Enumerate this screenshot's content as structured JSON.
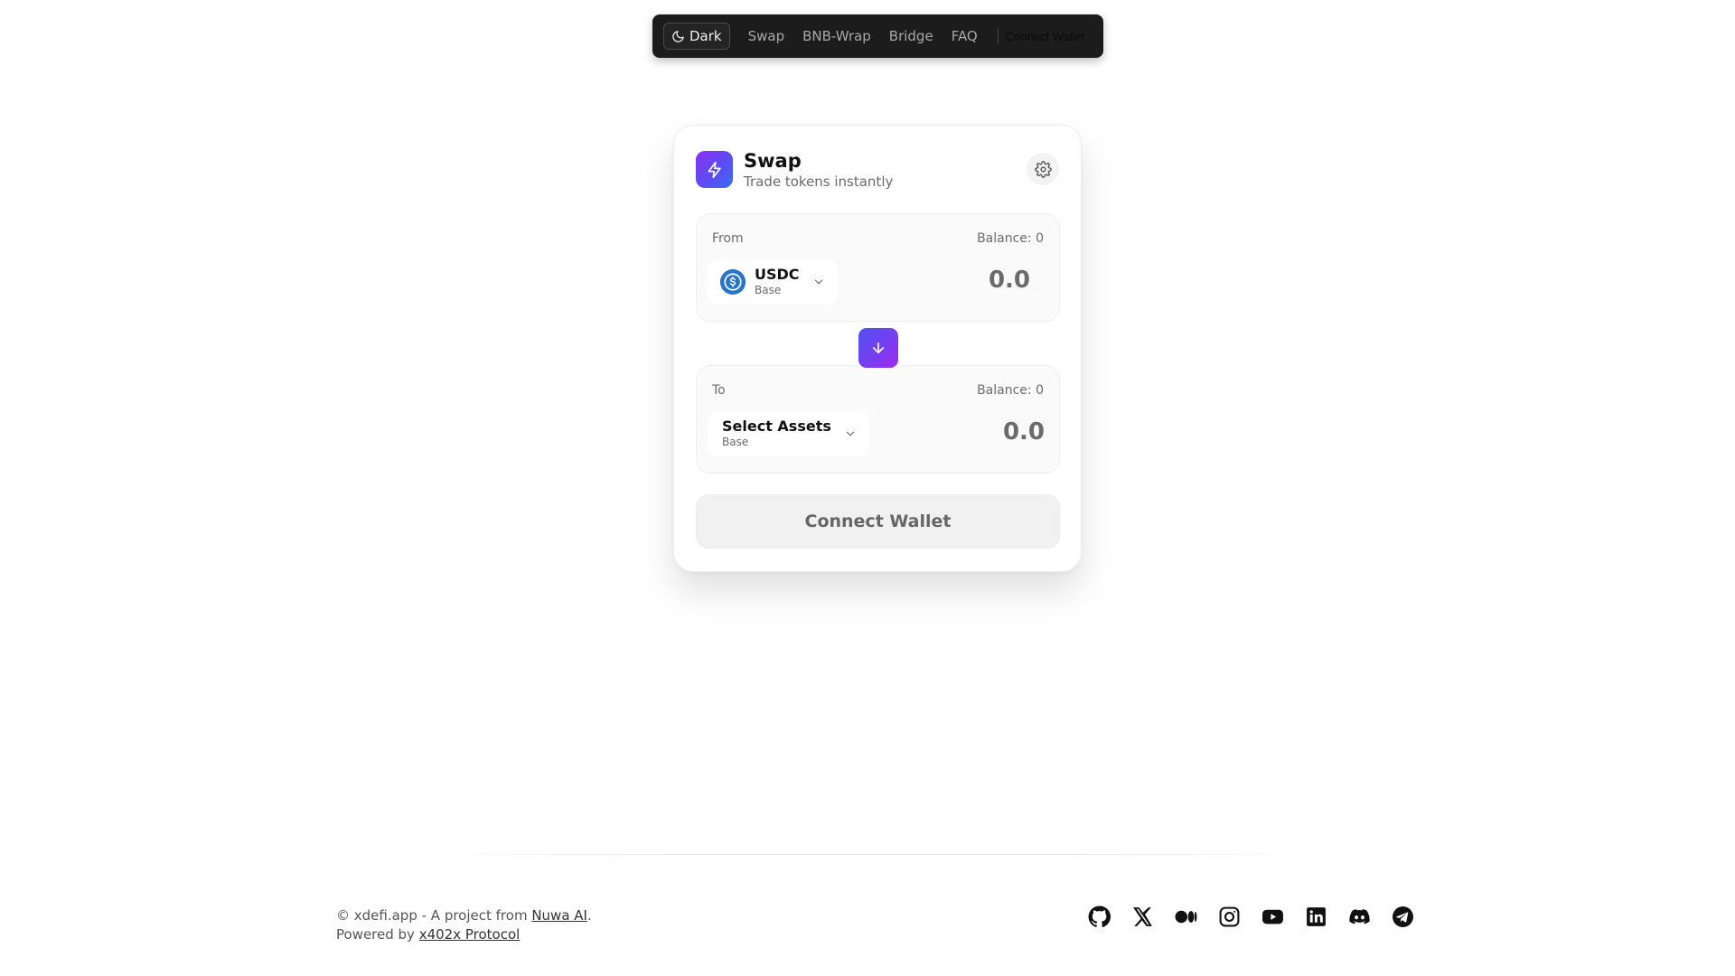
{
  "nav": {
    "theme_label": "Dark",
    "links": [
      "Swap",
      "BNB-Wrap",
      "Bridge",
      "FAQ"
    ],
    "connect_label": "Connect Wallet"
  },
  "swap": {
    "title": "Swap",
    "subtitle": "Trade tokens instantly",
    "from": {
      "label": "From",
      "balance": "Balance: 0",
      "token_symbol": "USDC",
      "token_network": "Base",
      "amount": "0.0"
    },
    "to": {
      "label": "To",
      "balance": "Balance: 0",
      "token_symbol": "Select Assets",
      "token_network": "Base",
      "amount": "0.0"
    },
    "connect_button": "Connect Wallet"
  },
  "footer": {
    "copyright_prefix": "© xdefi.app - A project from ",
    "project_link": "Nuwa AI",
    "copyright_suffix": ".",
    "powered_prefix": "Powered by ",
    "powered_link": "x402x Protocol",
    "socials": [
      "github-icon",
      "x-icon",
      "medium-icon",
      "instagram-icon",
      "youtube-icon",
      "linkedin-icon",
      "discord-icon",
      "telegram-icon"
    ]
  },
  "colors": {
    "accent_start": "#8b2ff0",
    "accent_end": "#3a6cf7",
    "usdc_blue": "#2775ca",
    "nav_bg": "#1c1c1c"
  }
}
